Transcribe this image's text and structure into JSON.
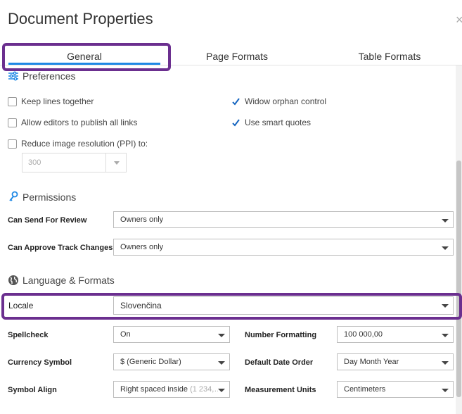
{
  "dialog": {
    "title": "Document Properties",
    "close_label": "×"
  },
  "tabs": [
    {
      "label": "General",
      "active": true
    },
    {
      "label": "Page Formats",
      "active": false
    },
    {
      "label": "Table Formats",
      "active": false
    }
  ],
  "preferences": {
    "heading": "Preferences",
    "options": [
      {
        "label": "Keep lines together",
        "checked": false
      },
      {
        "label": "Widow orphan control",
        "checked": true
      },
      {
        "label": "Allow editors to publish all links",
        "checked": false
      },
      {
        "label": "Use smart quotes",
        "checked": true
      },
      {
        "label": "Reduce image resolution (PPI) to:",
        "checked": false
      }
    ],
    "ppi_value": "300"
  },
  "permissions": {
    "heading": "Permissions",
    "can_send_for_review": {
      "label": "Can Send For Review",
      "value": "Owners only"
    },
    "can_approve_track_changes": {
      "label": "Can Approve Track Changes",
      "value": "Owners only"
    }
  },
  "language": {
    "heading": "Language & Formats",
    "locale": {
      "label": "Locale",
      "value": "Slovenčina"
    },
    "spellcheck": {
      "label": "Spellcheck",
      "value": "On"
    },
    "number_formatting": {
      "label": "Number Formatting",
      "value": "100 000,00"
    },
    "currency_symbol": {
      "label": "Currency Symbol",
      "value": "$ (Generic Dollar)"
    },
    "default_date_order": {
      "label": "Default Date Order",
      "value": "Day Month Year"
    },
    "symbol_align": {
      "label": "Symbol Align",
      "value": "Right spaced inside",
      "value_hint": "(1 234,…"
    },
    "measurement_units": {
      "label": "Measurement Units",
      "value": "Centimeters"
    }
  },
  "colors": {
    "accent": "#1e88e5",
    "highlight": "#6b2f8f",
    "check": "#1565c0",
    "icon": "#555555"
  }
}
